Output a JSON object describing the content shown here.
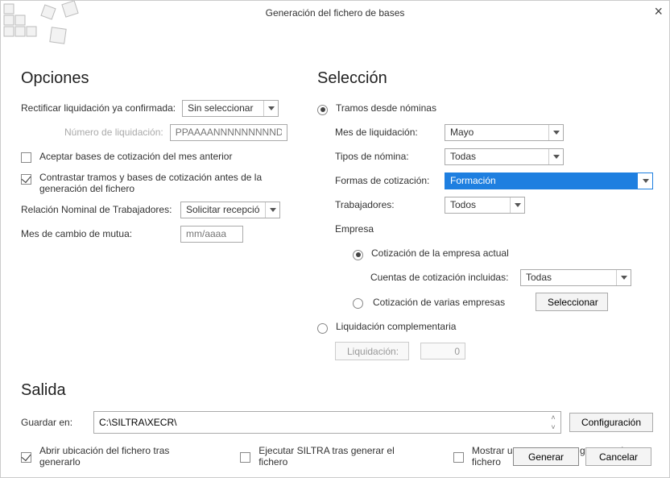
{
  "window": {
    "title": "Generación del fichero de bases"
  },
  "opciones": {
    "heading": "Opciones",
    "rectificar_label": "Rectificar liquidación ya confirmada:",
    "rectificar_value": "Sin seleccionar",
    "numero_liq_label": "Número de liquidación:",
    "numero_liq_placeholder": "PPAAAANNNNNNNNNDC",
    "aceptar_bases_label": "Aceptar bases de cotización del mes anterior",
    "contrastar_label": "Contrastar tramos y bases de cotización antes de la generación del fichero",
    "relacion_nominal_label": "Relación Nominal de Trabajadores:",
    "relacion_nominal_value": "Solicitar recepció",
    "mes_cambio_label": "Mes de cambio de mutua:",
    "mes_cambio_placeholder": "mm/aaaa"
  },
  "seleccion": {
    "heading": "Selección",
    "tramos_radio_label": "Tramos desde nóminas",
    "mes_liq_label": "Mes de liquidación:",
    "mes_liq_value": "Mayo",
    "tipos_nomina_label": "Tipos de nómina:",
    "tipos_nomina_value": "Todas",
    "formas_cot_label": "Formas de cotización:",
    "formas_cot_value": "Formación",
    "trabajadores_label": "Trabajadores:",
    "trabajadores_value": "Todos",
    "empresa_label": "Empresa",
    "cot_actual_label": "Cotización de la empresa actual",
    "cuentas_incl_label": "Cuentas de cotización incluidas:",
    "cuentas_incl_value": "Todas",
    "cot_varias_label": "Cotización de varias empresas",
    "seleccionar_btn": "Seleccionar",
    "liq_compl_label": "Liquidación complementaria",
    "liq_btn_label": "Liquidación:",
    "liq_num_value": "0"
  },
  "salida": {
    "heading": "Salida",
    "guardar_label": "Guardar en:",
    "path_value": "C:\\SILTRA\\XECR\\",
    "config_btn": "Configuración",
    "abrir_ubicacion_label": "Abrir ubicación del fichero tras generarlo",
    "ejecutar_siltra_label": "Ejecutar SILTRA tras generar el fichero",
    "mostrar_resumen_label": "Mostrar un resumen tras generar el fichero"
  },
  "footer": {
    "generar": "Generar",
    "cancelar": "Cancelar"
  }
}
